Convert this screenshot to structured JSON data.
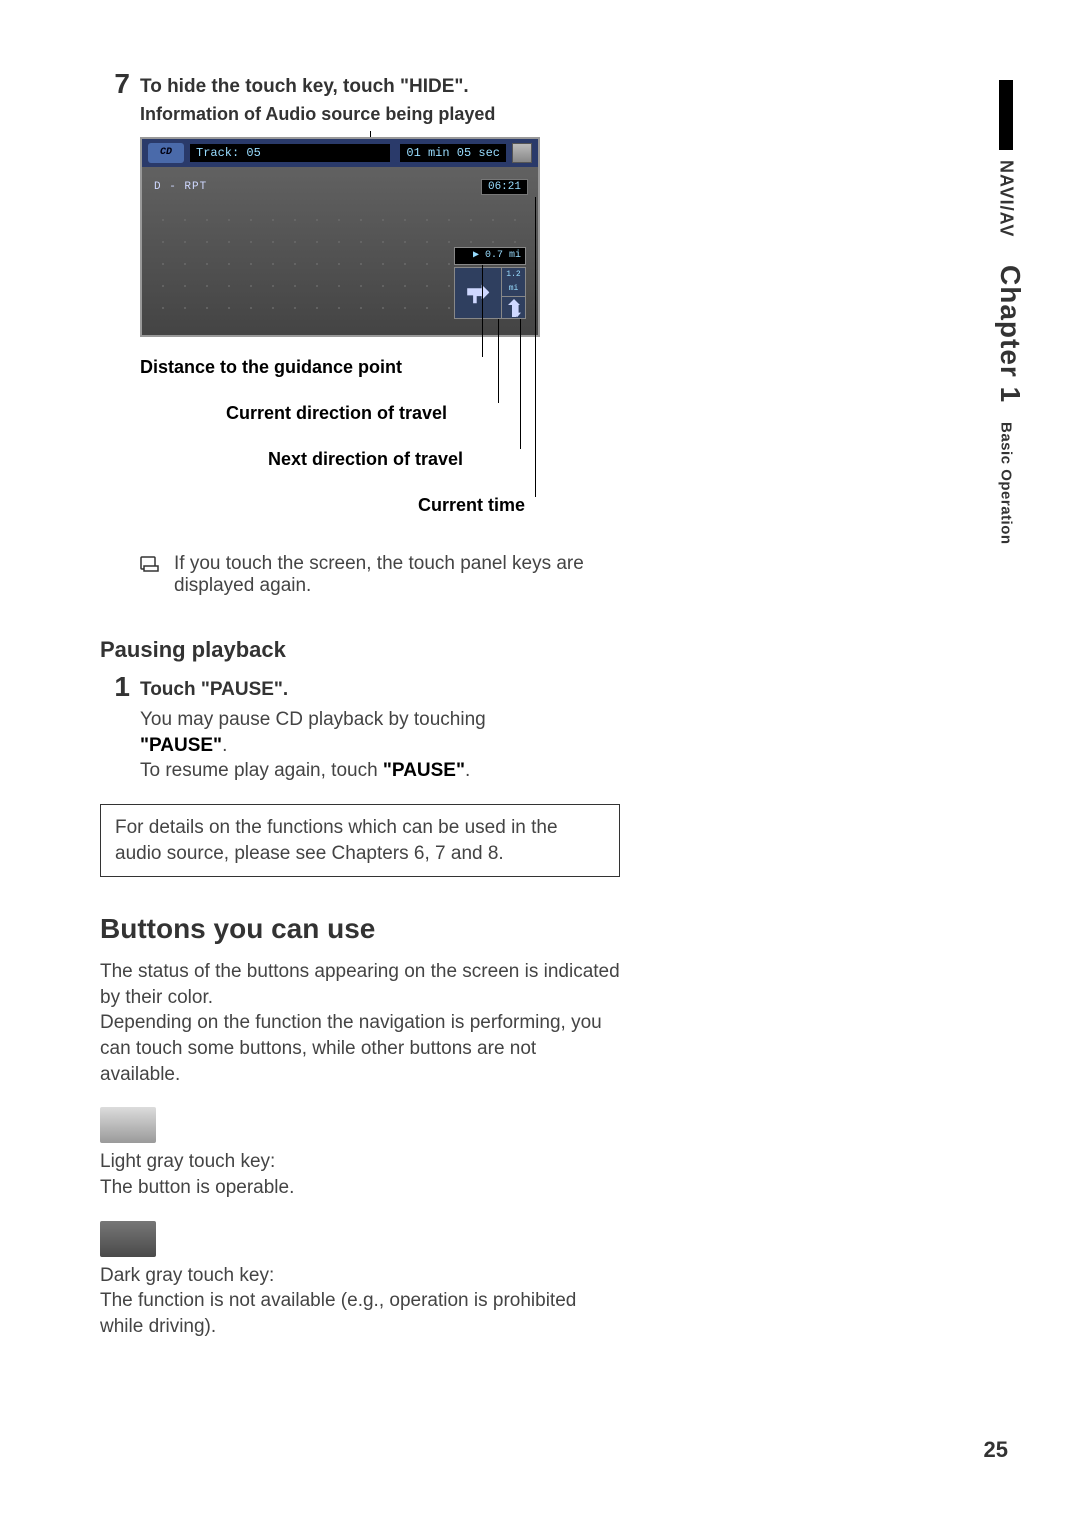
{
  "step7": {
    "num": "7",
    "title": "To hide the touch key, touch \"HIDE\".",
    "subtitle": "Information of Audio source being played"
  },
  "screenshot": {
    "cd_label": "CD",
    "track": "Track: 05",
    "elapsed": "01 min   05 sec",
    "mode": "D - RPT",
    "clock": "06:21",
    "dist": "▶ 0.7 mi",
    "next_dist": "1.2 mi"
  },
  "callouts": {
    "dist": "Distance to the guidance point",
    "cur_dir": "Current direction of travel",
    "next_dir": "Next direction of travel",
    "cur_time": "Current time"
  },
  "note7": "If you touch the screen, the touch panel keys are displayed again.",
  "pausing": {
    "heading": "Pausing playback",
    "step_num": "1",
    "step_title": "Touch \"PAUSE\".",
    "line1a": "You may pause CD playback by touching ",
    "line1b": "\"PAUSE\"",
    "line1c": ".",
    "line2a": "To resume play again, touch ",
    "line2b": "\"PAUSE\"",
    "line2c": "."
  },
  "box": "For details on the functions which can be used in the audio source, please see Chapters 6, 7 and 8.",
  "buttons": {
    "heading": "Buttons you can use",
    "intro": "The status of the buttons appearing on the screen is indicated by their color.\nDepending on the function the navigation is performing, you can touch some buttons, while other buttons are not available.",
    "light1": "Light gray touch key:",
    "light2": "The button is operable.",
    "dark1": "Dark gray touch key:",
    "dark2": "The function is not available (e.g., operation is prohibited while driving)."
  },
  "side": {
    "naviav": "NAVI/AV",
    "chapter": "Chapter 1",
    "section": "Basic Operation"
  },
  "page": "25"
}
